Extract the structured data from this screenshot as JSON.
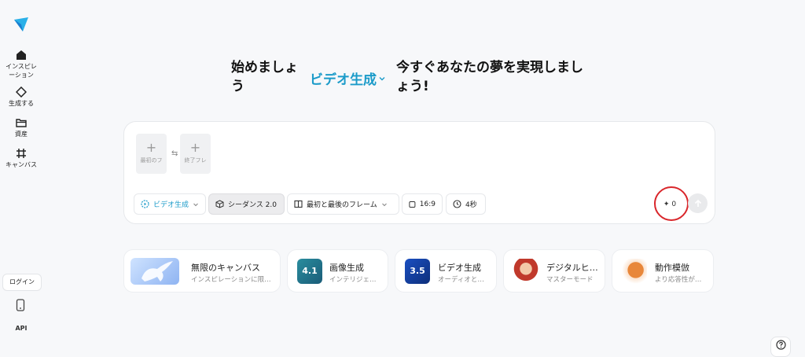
{
  "sidebar": {
    "items": [
      {
        "label": "インスピレ\nーション",
        "icon": "home-icon"
      },
      {
        "label": "生成する",
        "icon": "diamond-icon"
      },
      {
        "label": "資産",
        "icon": "folder-icon"
      },
      {
        "label": "キャンバス",
        "icon": "canvas-icon"
      }
    ],
    "login_label": "ログイン",
    "api_label": "API"
  },
  "hero": {
    "part1_line1": "始めましょ",
    "part1_line2": "う",
    "mode_label": "ビデオ生成",
    "part2_line1": "今すぐあなたの夢を実現しまし",
    "part2_line2": "ょう!"
  },
  "composer": {
    "first_frame_label": "最初のフ",
    "last_frame_label": "終了フレ",
    "mode_chip": "ビデオ生成",
    "model_chip": "シーダンス 2.0",
    "frame_chip": "最初と最後のフレーム",
    "ratio_chip": "16:9",
    "duration_chip": "4秒",
    "credit_count": "0"
  },
  "cards": [
    {
      "title": "無限のキャンバス",
      "subtitle": "インスピレーションに限…"
    },
    {
      "title": "画像生成",
      "subtitle": "インテリジェ…",
      "badge": "4.1"
    },
    {
      "title": "ビデオ生成",
      "subtitle": "オーディオと…",
      "badge": "3.5"
    },
    {
      "title": "デジタルヒ…",
      "subtitle": "マスターモード"
    },
    {
      "title": "動作模倣",
      "subtitle": "より応答性が…"
    }
  ],
  "colors": {
    "accent": "#1b9bc9",
    "highlight_ring": "#d9262b"
  }
}
